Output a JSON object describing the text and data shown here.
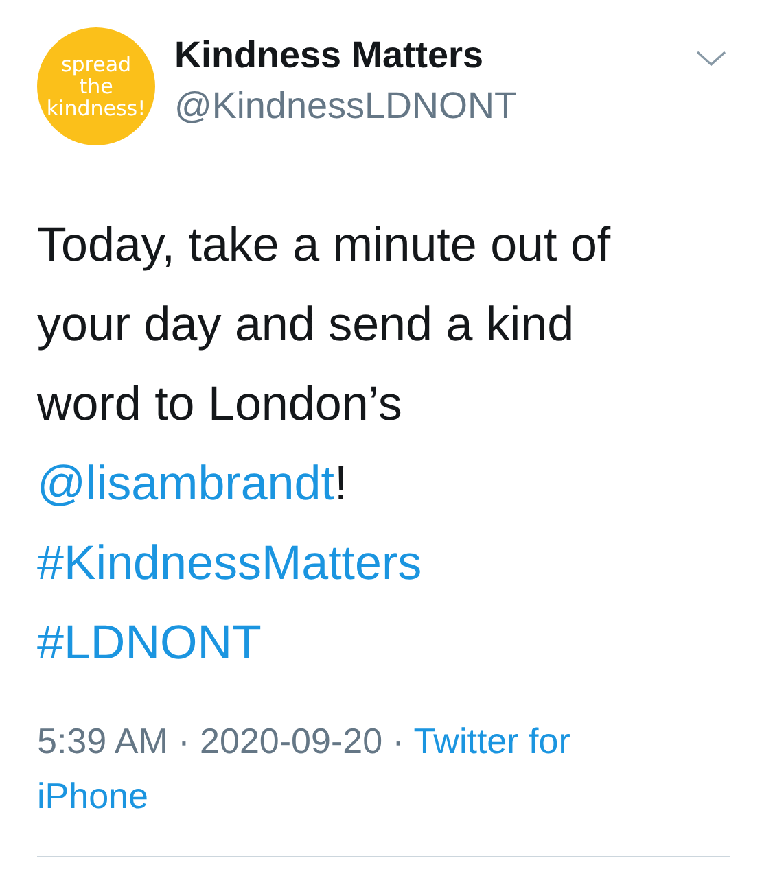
{
  "author": {
    "avatar_lines": [
      "spread",
      "the",
      "kindness!"
    ],
    "name": "Kindness Matters",
    "handle": "@KindnessLDNONT"
  },
  "body": [
    [
      {
        "kind": "text",
        "text": "Today, take a minute out of"
      }
    ],
    [
      {
        "kind": "text",
        "text": "your day and send a kind"
      }
    ],
    [
      {
        "kind": "text",
        "text": "word to London’s"
      }
    ],
    [
      {
        "kind": "mention",
        "text": "@lisambrandt"
      },
      {
        "kind": "text",
        "text": "!"
      }
    ],
    [
      {
        "kind": "hashtag",
        "text": "#KindnessMatters"
      }
    ],
    [
      {
        "kind": "hashtag",
        "text": "#LDNONT"
      }
    ]
  ],
  "meta": {
    "time": "5:39 AM",
    "separator_1": "·",
    "date": "2020-09-20",
    "separator_2": "·",
    "source_lines": [
      "Twitter for",
      "iPhone"
    ]
  }
}
